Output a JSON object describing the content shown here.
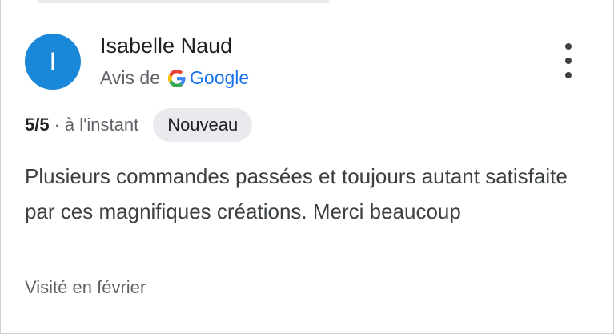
{
  "review": {
    "avatar_initial": "I",
    "reviewer_name": "Isabelle Naud",
    "source_prefix": "Avis de",
    "source_brand": "Google",
    "source_icon": "google-g-icon",
    "more_icon": "more-vert-icon",
    "rating": "5/5",
    "separator": "·",
    "time": "à l'instant",
    "badge": "Nouveau",
    "text": "Plusieurs commandes passées et toujours autant satisfaite par ces magnifiques créations. Merci beaucoup",
    "visited": "Visité en février"
  },
  "colors": {
    "avatar_bg": "#1a88d8",
    "brand_link": "#1a73e8",
    "badge_bg": "#e8eaed",
    "secondary_text": "#5f6368"
  }
}
